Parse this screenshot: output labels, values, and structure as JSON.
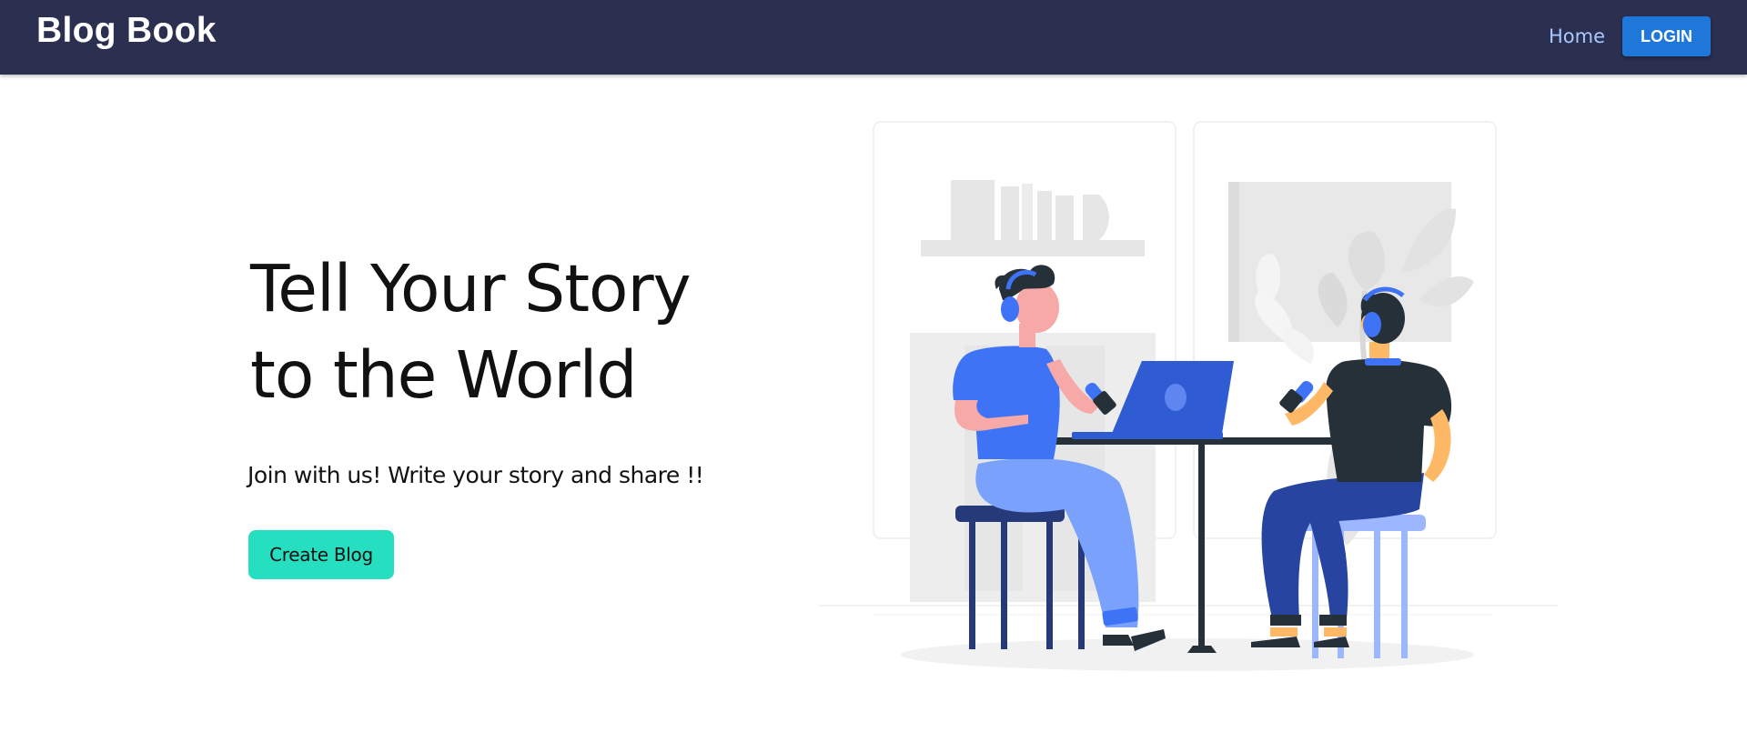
{
  "navbar": {
    "brand": "Blog Book",
    "home_label": "Home",
    "login_label": "LOGIN"
  },
  "hero": {
    "title_line1": "Tell Your Story",
    "title_line2": "to the World",
    "subtitle": "Join with us! Write your story and share !!",
    "create_button_label": "Create Blog"
  },
  "colors": {
    "navbar_bg": "#2b2f50",
    "login_button": "#1f78d9",
    "home_link": "#a9c8ff",
    "create_button": "#26dfc0",
    "accent_blue": "#3f73f5"
  },
  "illustration": {
    "icon": "podcast-illustration"
  }
}
